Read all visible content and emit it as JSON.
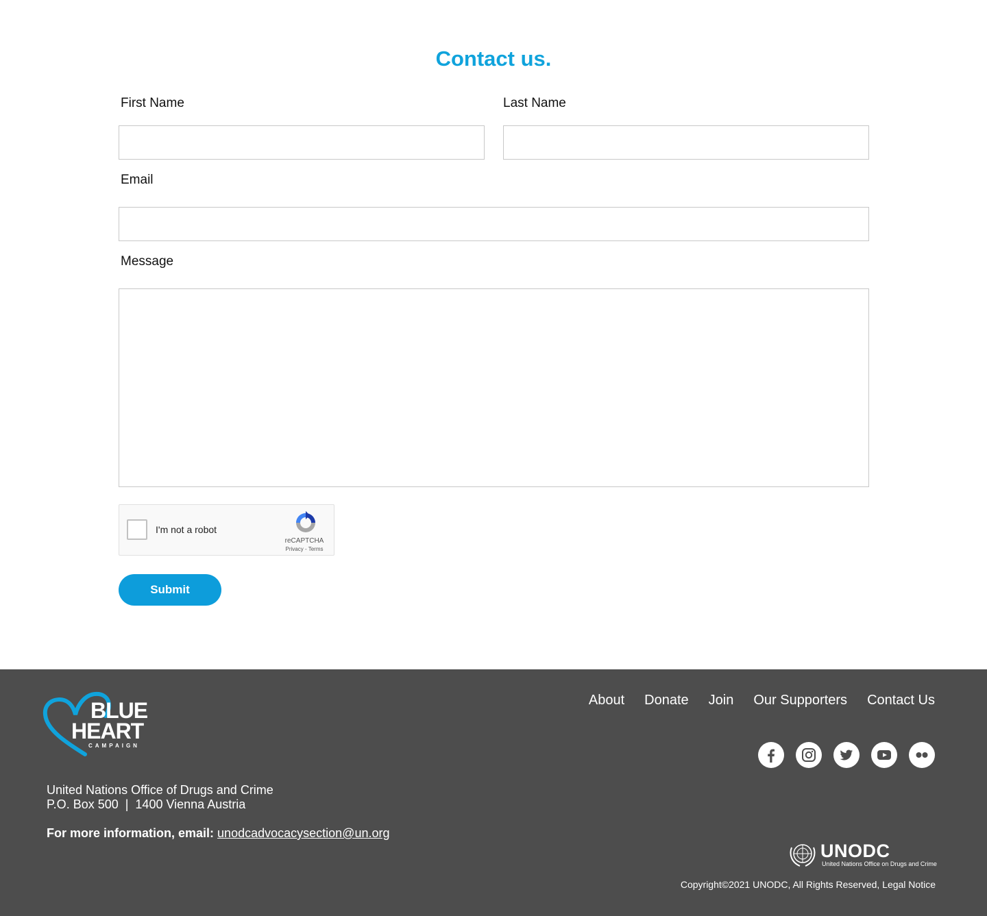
{
  "page": {
    "title": "Contact us."
  },
  "form": {
    "first_name_label": "First Name",
    "last_name_label": "Last Name",
    "email_label": "Email",
    "message_label": "Message",
    "first_name_value": "",
    "last_name_value": "",
    "email_value": "",
    "message_value": "",
    "submit_label": "Submit"
  },
  "captcha": {
    "label": "I'm not a robot",
    "brand": "reCAPTCHA",
    "links": "Privacy - Terms",
    "checked": false
  },
  "footer": {
    "logo": {
      "line1": "BLUE",
      "line2": "HEART",
      "line3": "CAMPAIGN"
    },
    "address_line1": "United Nations Office of Drugs and Crime",
    "address_line2": "P.O. Box 500  |  1400 Vienna Austria",
    "info_label": "For more information, email:",
    "info_email": "unodcadvocacysection@un.org",
    "nav": [
      "About",
      "Donate",
      "Join",
      "Our Supporters",
      "Contact Us"
    ],
    "social": [
      "facebook-icon",
      "instagram-icon",
      "twitter-icon",
      "youtube-icon",
      "flickr-icon"
    ],
    "unodc_name": "UNODC",
    "unodc_sub": "United Nations Office on Drugs and Crime",
    "copyright": "Copyright©2021 UNODC, All Rights Reserved, Legal Notice"
  },
  "colors": {
    "accent": "#10a3dc",
    "button": "#0d9ddb",
    "footer_bg": "#4d4d4d"
  }
}
